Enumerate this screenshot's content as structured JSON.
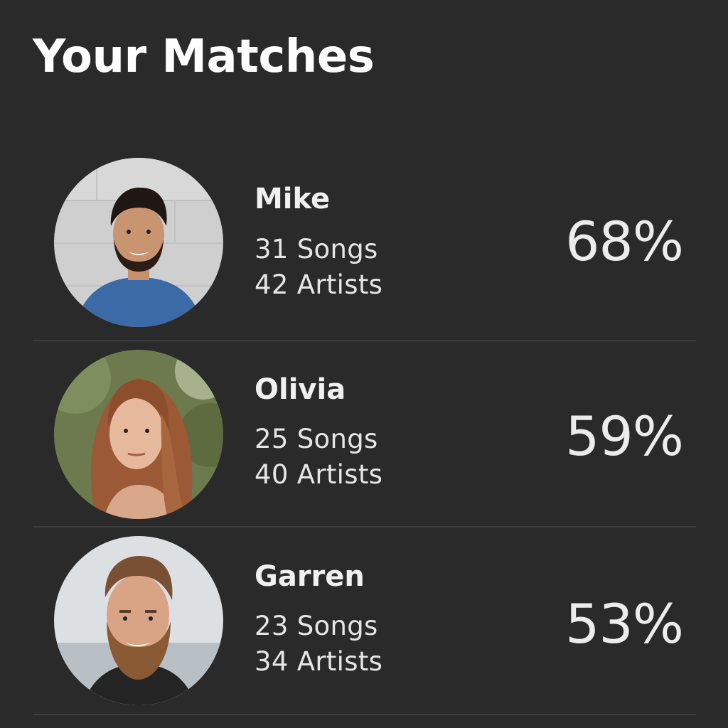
{
  "header": {
    "title": "Your Matches"
  },
  "matches": [
    {
      "name": "Mike",
      "songs": "31 Songs",
      "artists": "42 Artists",
      "percent": "68%",
      "avatar": "avatar-photo-mike"
    },
    {
      "name": "Olivia",
      "songs": "25 Songs",
      "artists": "40 Artists",
      "percent": "59%",
      "avatar": "avatar-photo-olivia"
    },
    {
      "name": "Garren",
      "songs": "23 Songs",
      "artists": "34 Artists",
      "percent": "53%",
      "avatar": "avatar-photo-garren"
    }
  ],
  "colors": {
    "background": "#2a2a2a",
    "text": "#ececec",
    "divider": "#3d3d3d"
  }
}
